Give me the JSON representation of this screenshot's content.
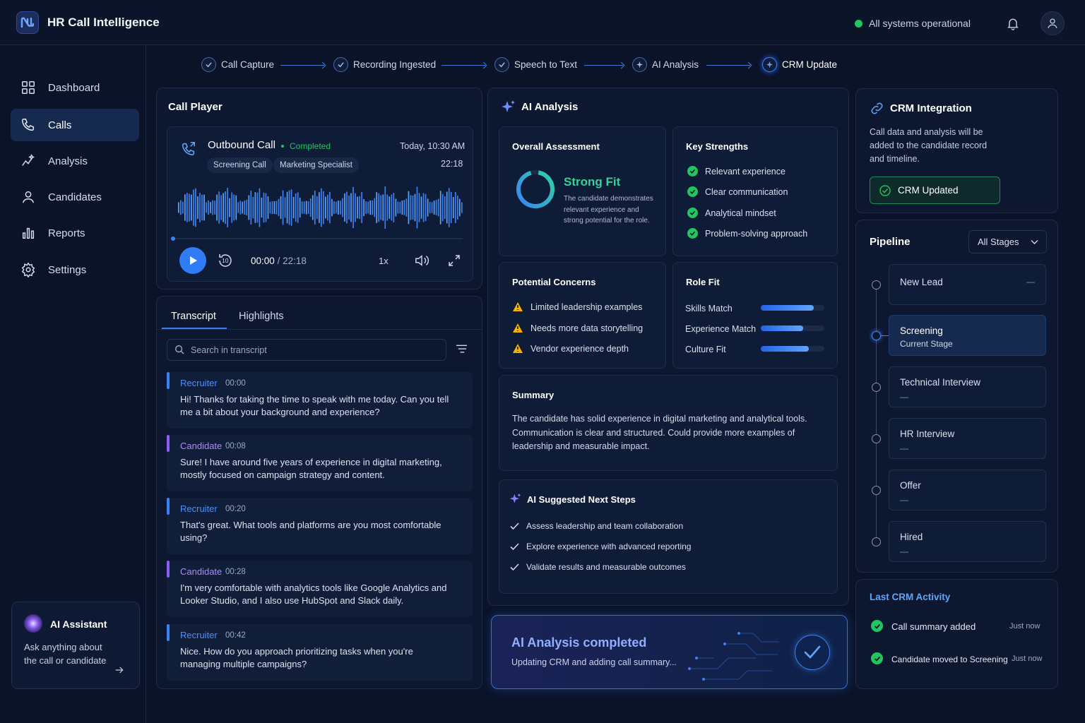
{
  "app": {
    "title": "HR Call Intelligence",
    "status": "All systems operational"
  },
  "nav": {
    "items": [
      {
        "label": "Dashboard",
        "icon": "grid-icon"
      },
      {
        "label": "Calls",
        "icon": "phone-icon"
      },
      {
        "label": "Analysis",
        "icon": "analysis-icon"
      },
      {
        "label": "Candidates",
        "icon": "user-icon"
      },
      {
        "label": "Reports",
        "icon": "bar-chart-icon"
      },
      {
        "label": "Settings",
        "icon": "gear-icon"
      }
    ]
  },
  "assistant": {
    "title": "AI Assistant",
    "text": "Ask anything about the call or candidate"
  },
  "steps": [
    "Call Capture",
    "Recording Ingested",
    "Speech to Text",
    "AI Analysis",
    "CRM Update"
  ],
  "player": {
    "title": "Call Player",
    "call_type": "Outbound Call",
    "status": "Completed",
    "time": "Today, 10:30 AM",
    "duration": "22:18",
    "tags": [
      "Screening Call",
      "Marketing Specialist"
    ],
    "current": "00:00",
    "sep": "/",
    "total": "22:18",
    "speed": "1x",
    "skip": "10",
    "progress": 0
  },
  "transcript": {
    "tabs": [
      "Transcript",
      "Highlights"
    ],
    "search_placeholder": "Search in transcript",
    "messages": [
      {
        "who": "Recruiter",
        "ts": "00:00",
        "text": "Hi! Thanks for taking the time to speak with me today. Can you tell me a bit about your background and experience?"
      },
      {
        "who": "Candidate",
        "ts": "00:08",
        "text": "Sure! I have around five years of experience in digital marketing, mostly focused on campaign strategy and content."
      },
      {
        "who": "Recruiter",
        "ts": "00:20",
        "text": "That's great. What tools and platforms are you most comfortable using?"
      },
      {
        "who": "Candidate",
        "ts": "00:28",
        "text": "I'm very comfortable with analytics tools like Google Analytics and Looker Studio, and I also use HubSpot and Slack daily."
      },
      {
        "who": "Recruiter",
        "ts": "00:42",
        "text": "Nice. How do you approach prioritizing tasks when you're managing multiple campaigns?"
      }
    ]
  },
  "analysis": {
    "title": "AI Analysis",
    "overall": {
      "title": "Overall Assessment",
      "verdict": "Strong Fit",
      "text": "The candidate demonstrates relevant experience and strong potential for the role."
    },
    "strengths": {
      "title": "Key Strengths",
      "items": [
        "Relevant experience",
        "Clear communication",
        "Analytical mindset",
        "Problem-solving approach"
      ]
    },
    "concerns": {
      "title": "Potential Concerns",
      "items": [
        "Limited leadership examples",
        "Needs more data storytelling",
        "Vendor experience depth"
      ]
    },
    "role_fit": {
      "title": "Role Fit",
      "items": [
        {
          "label": "Skills Match",
          "value": 0.83
        },
        {
          "label": "Experience Match",
          "value": 0.67
        },
        {
          "label": "Culture Fit",
          "value": 0.75
        }
      ]
    },
    "summary": {
      "title": "Summary",
      "text": "The candidate has solid experience in digital marketing and analytical tools. Communication is clear and structured. Could provide more examples of leadership and measurable impact."
    },
    "next_steps": {
      "title": "AI Suggested Next Steps",
      "items": [
        "Assess leadership and team collaboration",
        "Explore experience with advanced reporting",
        "Validate results and measurable outcomes"
      ]
    },
    "banner": {
      "title": "AI Analysis completed",
      "text": "Updating CRM and adding call summary..."
    }
  },
  "crm": {
    "title": "CRM Integration",
    "text": "Call data and analysis will be added to the candidate record and timeline.",
    "button": "CRM Updated"
  },
  "pipeline": {
    "title": "Pipeline",
    "filter": "All Stages",
    "stages": [
      {
        "name": "New Lead",
        "sub": "—"
      },
      {
        "name": "Screening",
        "sub": "Current Stage"
      },
      {
        "name": "Technical Interview",
        "sub": "—"
      },
      {
        "name": "HR Interview",
        "sub": "—"
      },
      {
        "name": "Offer",
        "sub": "—"
      },
      {
        "name": "Hired",
        "sub": "—"
      }
    ]
  },
  "activity": {
    "title": "Last CRM Activity",
    "items": [
      {
        "text": "Call summary added",
        "time": "Just now"
      },
      {
        "text": "Candidate moved to Screening",
        "time": "Just now"
      }
    ]
  },
  "colors": {
    "accent": "#3b82f6",
    "success": "#22c55e",
    "warning": "#f5b301",
    "candidate": "#8b5cf6"
  }
}
